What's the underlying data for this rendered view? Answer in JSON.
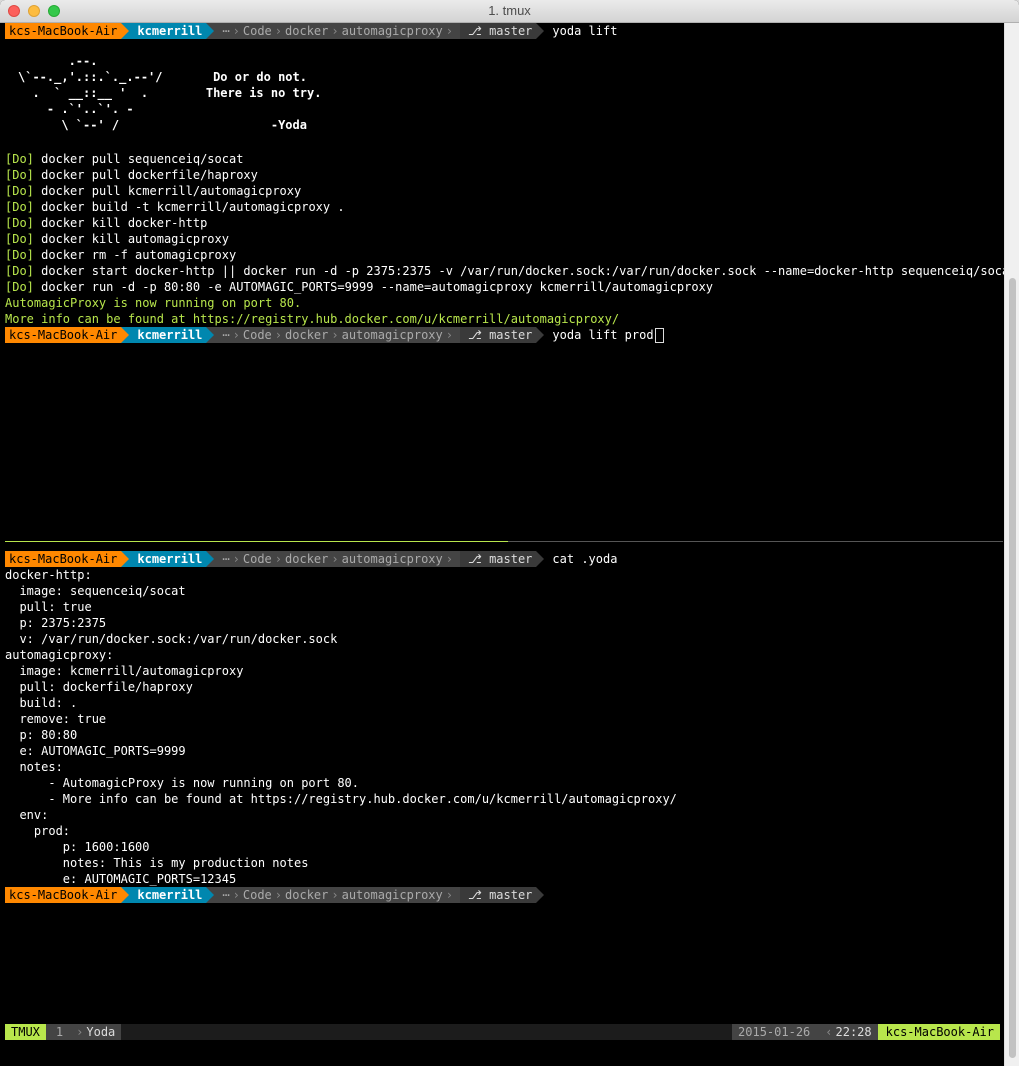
{
  "window": {
    "title": "1. tmux"
  },
  "prompt": {
    "host": "kcs-MacBook-Air",
    "user": "kcmerrill",
    "ellipsis": "⋯",
    "path": [
      "Code",
      "docker",
      "automagicproxy"
    ],
    "branch_icon": "⎇",
    "branch": "master"
  },
  "pane1": {
    "cmd1": "yoda lift",
    "yoda_art": "       .--.\n\\`--._,'.::.`._.--'/       Do or do not.\n  .  ` __::__ '  .        There is no try.\n    - .`'..`'. -\n      \\ `--' /                     -Yoda",
    "do_tag": "[Do]",
    "steps": [
      "docker pull sequenceiq/socat",
      "docker pull dockerfile/haproxy",
      "docker pull kcmerrill/automagicproxy",
      "docker build -t kcmerrill/automagicproxy .",
      "docker kill docker-http",
      "docker kill automagicproxy",
      "docker rm -f automagicproxy",
      "docker start docker-http || docker run -d -p 2375:2375 -v /var/run/docker.sock:/var/run/docker.sock --name=docker-http sequenceiq/socat",
      "docker run -d -p 80:80 -e AUTOMAGIC_PORTS=9999 --name=automagicproxy kcmerrill/automagicproxy"
    ],
    "notes": [
      "AutomagicProxy is now running on port 80.",
      "More info can be found at https://registry.hub.docker.com/u/kcmerrill/automagicproxy/"
    ],
    "cmd2": "yoda lift prod"
  },
  "pane2": {
    "cmd": "cat .yoda",
    "lines": [
      "docker-http:",
      "  image: sequenceiq/socat",
      "  pull: true",
      "  p: 2375:2375",
      "  v: /var/run/docker.sock:/var/run/docker.sock",
      "automagicproxy:",
      "  image: kcmerrill/automagicproxy",
      "  pull: dockerfile/haproxy",
      "  build: .",
      "  remove: true",
      "  p: 80:80",
      "  e: AUTOMAGIC_PORTS=9999",
      "  notes:",
      "      - AutomagicProxy is now running on port 80.",
      "      - More info can be found at https://registry.hub.docker.com/u/kcmerrill/automagicproxy/",
      "  env:",
      "    prod:",
      "        p: 1600:1600",
      "        notes: This is my production notes",
      "        e: AUTOMAGIC_PORTS=12345"
    ]
  },
  "statusbar": {
    "session": "TMUX",
    "window_index": "1",
    "window_name": "Yoda",
    "date": "2015-01-26",
    "time": "22:28",
    "host": "kcs-MacBook-Air"
  },
  "colors": {
    "accent_green": "#b8e64c",
    "host_orange": "#ff8800",
    "user_blue": "#0087af"
  }
}
